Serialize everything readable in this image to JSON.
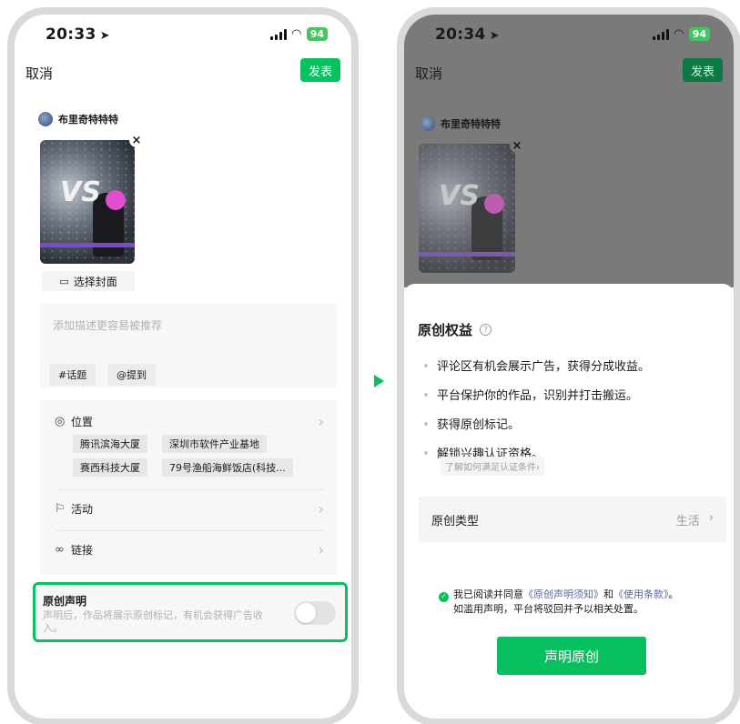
{
  "colors": {
    "accent": "#07c160",
    "link": "#576b95",
    "highlight_border": "#07c160"
  },
  "screen1": {
    "status": {
      "time": "20:33",
      "battery": "94"
    },
    "nav": {
      "cancel": "取消",
      "publish": "发表"
    },
    "user_name": "布里奇特特特",
    "cover_button": "选择封面",
    "description_placeholder": "添加描述更容易被推荐",
    "chips": {
      "topic": "#话题",
      "mention": "@提到"
    },
    "location": {
      "label": "位置",
      "suggestions": [
        "腾讯滨海大厦",
        "深圳市软件产业基地",
        "赛西科技大厦",
        "79号渔船海鲜饭店(科技..."
      ]
    },
    "activity_label": "活动",
    "link_label": "链接",
    "original": {
      "title": "原创声明",
      "description": "声明后，作品将展示原创标记，有机会获得广告收入。",
      "toggle_on": false
    }
  },
  "screen2": {
    "status": {
      "time": "20:34",
      "battery": "94"
    },
    "nav": {
      "cancel": "取消",
      "publish": "发表"
    },
    "user_name": "布里奇特特特",
    "sheet": {
      "title": "原创权益",
      "benefits": [
        "评论区有机会展示广告，获得分成收益。",
        "平台保护你的作品，识别并打击搬运。",
        "获得原创标记。",
        "解锁兴趣认证资格。"
      ],
      "learn_link": "了解如何满足认证条件",
      "type_label": "原创类型",
      "type_value": "生活",
      "agree_prefix": "我已阅读并同意",
      "agree_link1": "《原创声明须知》",
      "agree_and": "和",
      "agree_link2": "《使用条款》",
      "agree_end": "。",
      "agree_line2": "如滥用声明，平台将驳回并予以相关处置。",
      "declare_button": "声明原创"
    }
  }
}
